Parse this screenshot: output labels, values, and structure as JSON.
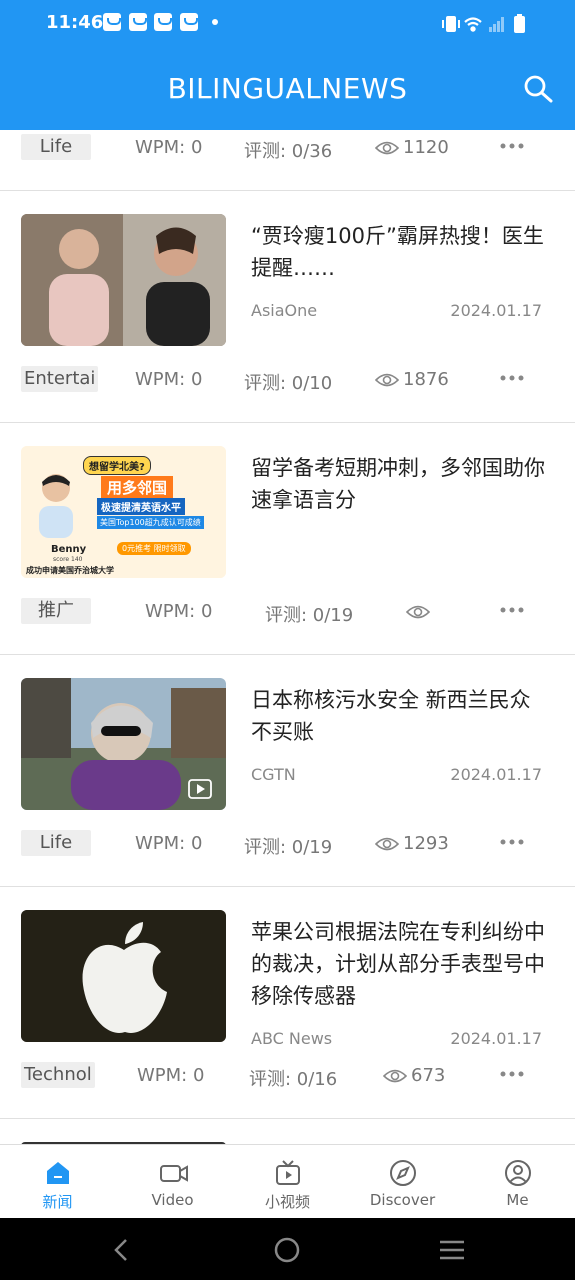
{
  "status_bar": {
    "time": "11:46"
  },
  "app_bar": {
    "title": "BILINGUALNEWS"
  },
  "rows": [
    {
      "tag": "Life",
      "wpm": "WPM: 0",
      "eval": "评测: 0/36",
      "views": "1120"
    },
    {
      "tag": "Entertai",
      "wpm": "WPM: 0",
      "eval": "评测: 0/10",
      "views": "1876"
    },
    {
      "tag": "推广",
      "wpm": "WPM: 0",
      "eval": "评测: 0/19",
      "views": ""
    },
    {
      "tag": "Life",
      "wpm": "WPM: 0",
      "eval": "评测: 0/19",
      "views": "1293"
    },
    {
      "tag": "Technol",
      "wpm": "WPM: 0",
      "eval": "评测: 0/16",
      "views": "673"
    }
  ],
  "articles": [
    {
      "title": "“贾玲瘦100斤”霸屏热搜！医生提醒……",
      "source": "AsiaOne",
      "date": "2024.01.17"
    },
    {
      "title": "留学备考短期冲刺，多邻国助你速拿语言分",
      "source": "",
      "date": "",
      "ad_banner": {
        "question": "想留学北美?",
        "headline": "用多邻国",
        "sub": "极速提清英语水平",
        "top": "美国Top100超九成认可成绩",
        "promo": "0元推考 限时领取",
        "name": "Benny",
        "score": "score 140",
        "footer": "成功申请美国乔治城大学"
      }
    },
    {
      "title": "日本称核污水安全 新西兰民众不买账",
      "source": "CGTN",
      "date": "2024.01.17"
    },
    {
      "title": "苹果公司根据法院在专利纠纷中的裁决，计划从部分手表型号中移除传感器",
      "source": "ABC News",
      "date": "2024.01.17"
    }
  ],
  "bottom_nav": [
    {
      "label": "新闻",
      "icon": "news-icon",
      "active": true
    },
    {
      "label": "Video",
      "icon": "video-camera-icon",
      "active": false
    },
    {
      "label": "小视频",
      "icon": "tv-play-icon",
      "active": false
    },
    {
      "label": "Discover",
      "icon": "compass-icon",
      "active": false
    },
    {
      "label": "Me",
      "icon": "person-icon",
      "active": false
    }
  ],
  "colors": {
    "primary": "#2196f3",
    "background": "#ffffff",
    "tag_bg": "#eeeeee"
  }
}
